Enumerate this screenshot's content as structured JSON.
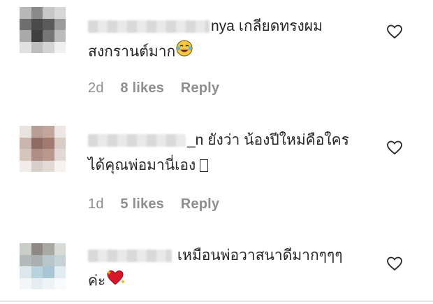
{
  "comments": [
    {
      "username_visible": "nya",
      "text_line1": "เกลียดทรงผม",
      "text_line2": "สงกรานต์มาก",
      "emoji": "face-with-tears-of-joy-icon",
      "time": "2d",
      "likes": "8 likes",
      "reply": "Reply",
      "avatar_colors": [
        "#b8b8b8",
        "#8a8a8a",
        "#c7c7c7",
        "#d7d7d7",
        "#6e6e6e",
        "#4a4a4a",
        "#5a5a5a",
        "#9b9b9b",
        "#a9a9a9",
        "#3f3f3f",
        "#777777",
        "#bcbcbc",
        "#e0e0e0",
        "#bdbdbd",
        "#d3d3d3",
        "#f0f0f0"
      ]
    },
    {
      "username_visible": "_n",
      "text_line1": "ยังว่า น้องปีใหม่คือใคร",
      "text_line2": "ได้คุณพ่อมานี่เอง",
      "emoji": "unrendered-glyph-box",
      "time": "1d",
      "likes": "5 likes",
      "reply": "Reply",
      "avatar_colors": [
        "#e9e3e0",
        "#b79f98",
        "#c3a69b",
        "#ece7e5",
        "#c9b5ad",
        "#8f6c63",
        "#a27a70",
        "#d9cbc5",
        "#d6c5bd",
        "#b08e84",
        "#b9978a",
        "#e3d9d4",
        "#f1ecea",
        "#d9cfca",
        "#e4dad5",
        "#f5f2f0"
      ]
    },
    {
      "username_visible": "",
      "text_line1": "เหมือนพ่อวาสนาดีมากๆๆๆ",
      "text_line2": "ค่ะ",
      "emoji": "sparkling-heart-icon",
      "time": "",
      "likes": "",
      "reply": "",
      "avatar_colors": [
        "#c9cec9",
        "#8e8a83",
        "#a8a9a3",
        "#d8dcd8",
        "#b2bbb9",
        "#aab0b2",
        "#b6c6cb",
        "#c8d2d4",
        "#dde6ea",
        "#b8d3de",
        "#a9c6d6",
        "#e2ecf0",
        "#f3f6f7",
        "#e5edf0",
        "#eef3f5",
        "#f8fafb"
      ]
    }
  ]
}
